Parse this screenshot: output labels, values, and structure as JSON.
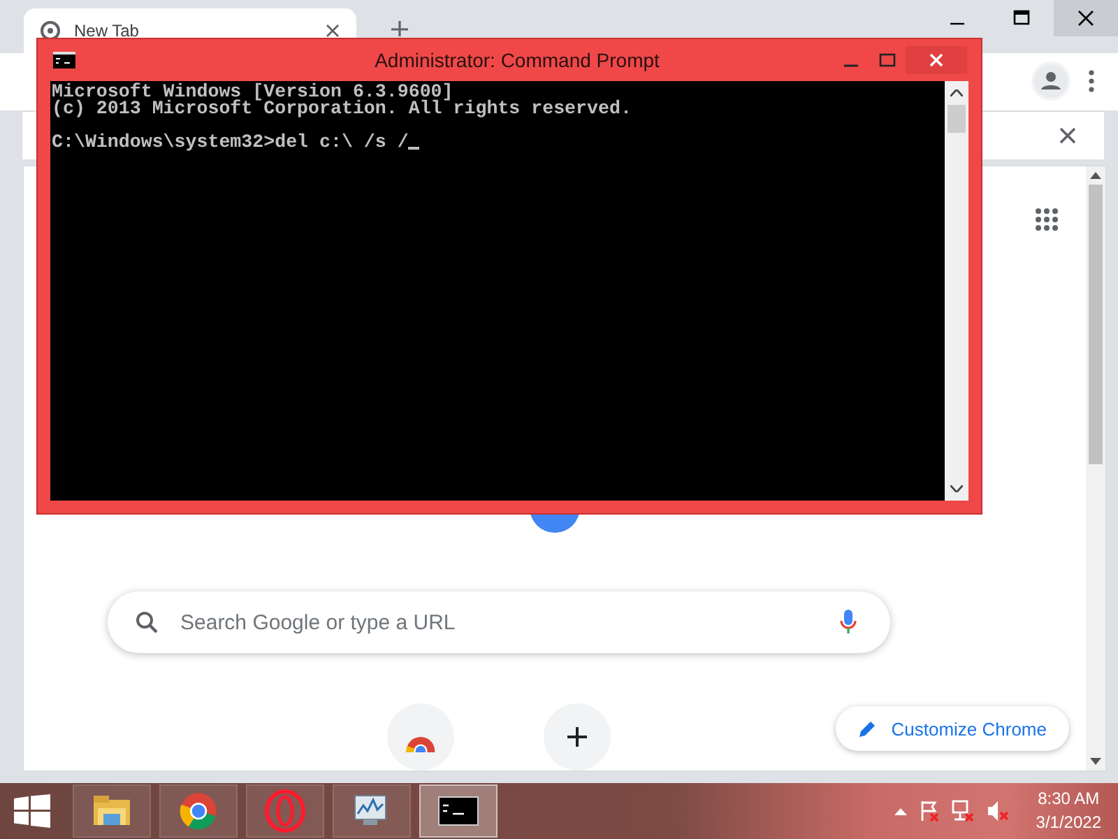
{
  "browser": {
    "tab": {
      "title": "New Tab",
      "selected": true
    },
    "search": {
      "placeholder": "Search Google or type a URL"
    },
    "shortcuts": [
      {
        "kind": "site"
      },
      {
        "kind": "add"
      }
    ],
    "customize_button": "Customize Chrome"
  },
  "console": {
    "title": "Administrator: Command Prompt",
    "paragraphs": [
      [
        "Microsoft Windows [Version 6.3.9600]",
        "(c) 2013 Microsoft Corporation. All rights reserved."
      ],
      [
        "C:\\Windows\\system32>del c:\\ /s /"
      ]
    ],
    "cursor": true
  },
  "taskbar": {
    "apps": [
      {
        "kind": "explorer",
        "selected": false
      },
      {
        "kind": "chrome",
        "selected": false
      },
      {
        "kind": "opera",
        "selected": false
      },
      {
        "kind": "monitor",
        "selected": false
      },
      {
        "kind": "console",
        "selected": true
      }
    ],
    "clock": {
      "time": "8:30 AM",
      "date": "3/1/2022"
    }
  }
}
